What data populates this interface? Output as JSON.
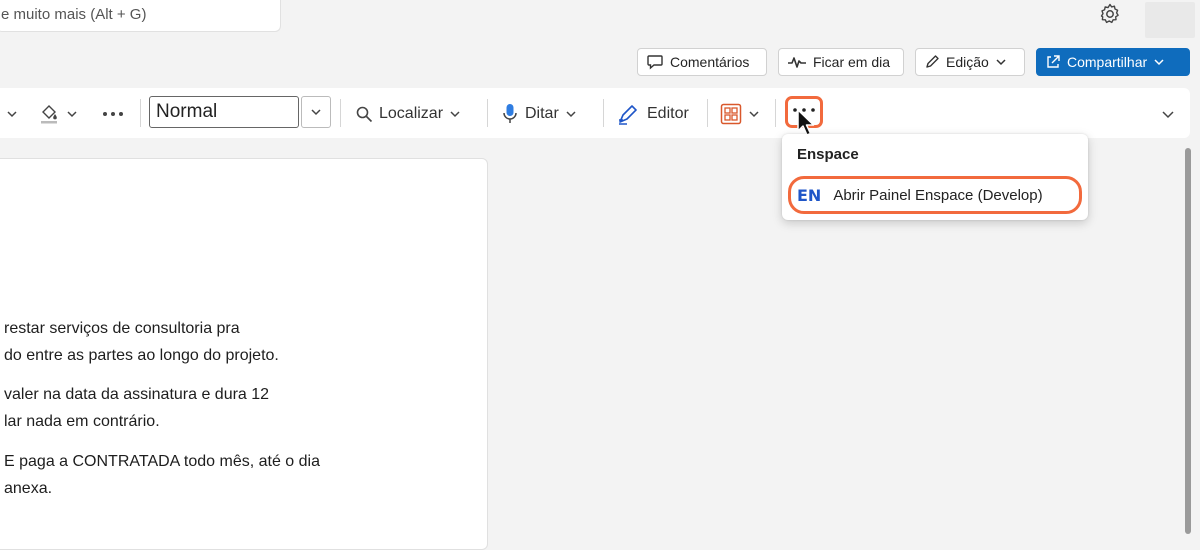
{
  "search": {
    "text": "e muito mais (Alt + G)"
  },
  "header": {
    "comments_label": "Comentários",
    "catchup_label": "Ficar em dia",
    "editing_label": "Edição",
    "share_label": "Compartilhar"
  },
  "ribbon": {
    "style_value": "Normal",
    "find_label": "Localizar",
    "dictate_label": "Ditar",
    "editor_label": "Editor",
    "more_label": "···"
  },
  "menu": {
    "header": "Enspace",
    "item_logo": "EN",
    "item_label": "Abrir Painel Enspace (Develop)"
  },
  "document": {
    "lines": [
      "restar serviços de consultoria pra",
      "do entre as partes ao longo do projeto.",
      "valer na data da assinatura e dura 12",
      "lar nada em contrário.",
      "E paga a CONTRATADA todo mês, até o dia",
      " anexa."
    ]
  },
  "colors": {
    "accent": "#0f6cbd",
    "highlight": "#f26a3d",
    "enspace_logo": "#1f56c8"
  }
}
